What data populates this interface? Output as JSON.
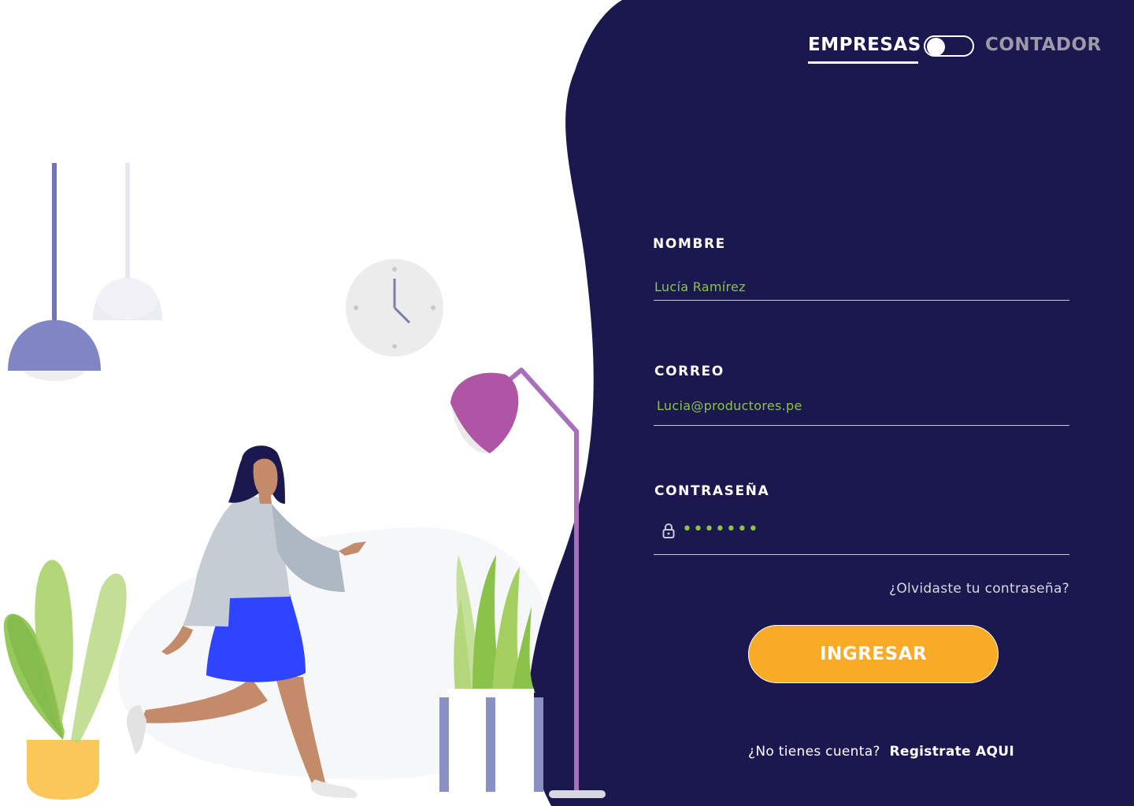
{
  "toggle": {
    "left_label": "EMPRESAS",
    "right_label": "CONTADOR",
    "selected": "EMPRESAS"
  },
  "form": {
    "name_label": "NOMBRE",
    "name_value": "Lucía Ramírez",
    "email_label": "CORREO",
    "email_value": "Lucia@productores.pe",
    "password_label": "CONTRASEÑA",
    "password_value": "•••••••",
    "forgot_link": "¿Olvidaste tu contraseña?",
    "submit_label": "INGRESAR",
    "register_prompt": "¿No tienes cuenta?",
    "register_link": "Registrate AQUI"
  },
  "icons": {
    "password": "lock-icon"
  },
  "colors": {
    "panel": "#1b184f",
    "accent": "#f9ab27",
    "field_text": "#8bc34a",
    "muted": "#9a9aa8"
  }
}
